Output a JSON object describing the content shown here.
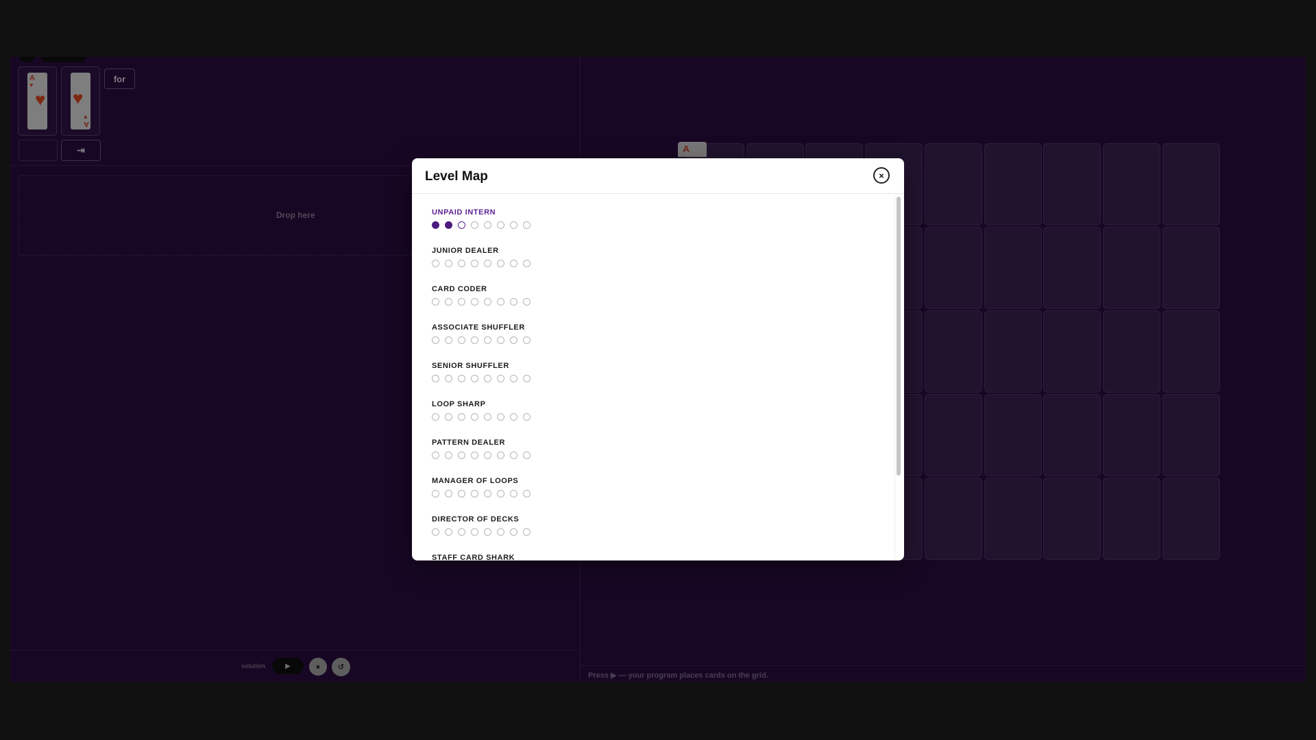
{
  "palette": {
    "cards": [
      {
        "corner": "A",
        "heart": "♥"
      },
      {
        "corner": "A",
        "heart": "♥"
      }
    ],
    "for_block": "for",
    "indent_block": "⇥"
  },
  "workspace": {
    "drop_label": "Drop here"
  },
  "controls": {
    "solution_label": "solution",
    "play": "▶",
    "stop": "■",
    "reset": "↺"
  },
  "grid": {
    "first_card_label": "A",
    "columns": 9,
    "rows": 5
  },
  "status": {
    "text": "Press ▶ — your program places cards on the grid."
  },
  "modal": {
    "title": "Level Map",
    "close": "×",
    "levels": [
      {
        "name": "UNPAID INTERN",
        "current": true,
        "done": 2,
        "active": 2
      },
      {
        "name": "JUNIOR DEALER",
        "current": false,
        "done": 0,
        "active": -1
      },
      {
        "name": "CARD CODER",
        "current": false,
        "done": 0,
        "active": -1
      },
      {
        "name": "ASSOCIATE SHUFFLER",
        "current": false,
        "done": 0,
        "active": -1
      },
      {
        "name": "SENIOR SHUFFLER",
        "current": false,
        "done": 0,
        "active": -1
      },
      {
        "name": "LOOP SHARP",
        "current": false,
        "done": 0,
        "active": -1
      },
      {
        "name": "PATTERN DEALER",
        "current": false,
        "done": 0,
        "active": -1
      },
      {
        "name": "MANAGER OF LOOPS",
        "current": false,
        "done": 0,
        "active": -1
      },
      {
        "name": "DIRECTOR OF DECKS",
        "current": false,
        "done": 0,
        "active": -1
      },
      {
        "name": "STAFF CARD SHARK",
        "current": false,
        "done": 0,
        "active": -1
      }
    ],
    "dots_per_level": 8
  },
  "colors": {
    "accent": "#5b2191",
    "done_dot": "#4d1c7e",
    "background": "#2a0d3f"
  }
}
